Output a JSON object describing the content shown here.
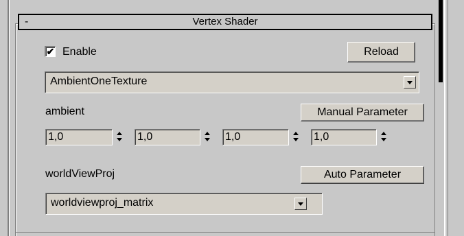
{
  "rollout": {
    "toggle": "-",
    "title": "Vertex Shader"
  },
  "enable": {
    "checked_mark": "✔",
    "label": "Enable"
  },
  "reload_button": "Reload",
  "program_select": {
    "value": "AmbientOneTexture"
  },
  "params": [
    {
      "name": "ambient",
      "mode_button": "Manual Parameter",
      "values": [
        "1,0",
        "1,0",
        "1,0",
        "1,0"
      ]
    },
    {
      "name": "worldViewProj",
      "mode_button": "Auto Parameter",
      "auto_value": "worldviewproj_matrix"
    }
  ]
}
